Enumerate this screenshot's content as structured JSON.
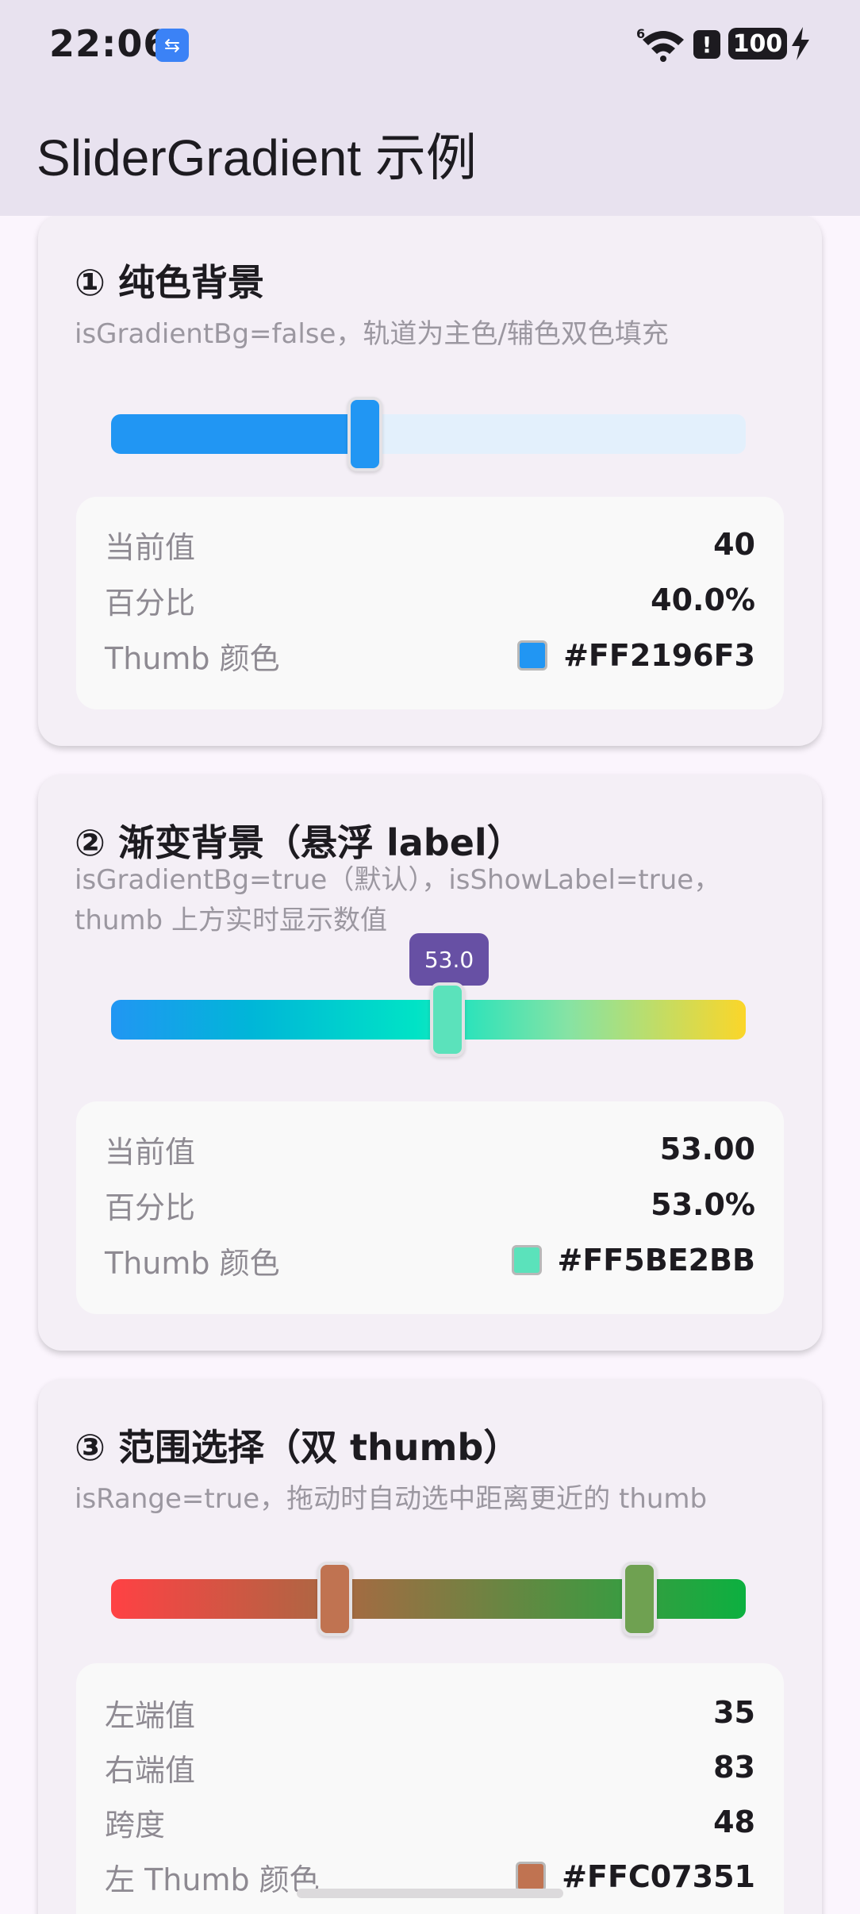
{
  "status_bar": {
    "time": "22:06",
    "usb_icon": "usb-icon",
    "signal_label": "6",
    "alert_glyph": "!",
    "battery": "100",
    "icons": [
      "usb-icon",
      "wifi-icon",
      "alert-icon",
      "battery-icon",
      "charging-bolt-icon"
    ]
  },
  "app_bar": {
    "title": "SliderGradient 示例"
  },
  "cards": [
    {
      "title": "① 纯色背景",
      "desc": "isGradientBg=false，轨道为主色/辅色双色填充",
      "slider": {
        "value": 40,
        "min": 0,
        "max": 100,
        "active_color": "#2196F3",
        "inactive_color": "#E3F0FC"
      },
      "rows": [
        {
          "key": "当前值",
          "value": "40"
        },
        {
          "key": "百分比",
          "value": "40.0%"
        },
        {
          "key": "Thumb 颜色",
          "value": "#FF2196F3",
          "swatch": "#2196F3"
        }
      ]
    },
    {
      "title": "② 渐变背景（悬浮 label）",
      "desc_line1": "isGradientBg=true（默认），isShowLabel=true，",
      "desc_line2": "thumb 上方实时显示数值",
      "slider": {
        "value": 53.0,
        "min": 0,
        "max": 100,
        "label": "53.0",
        "gradient": [
          "#2196F3",
          "#00D2D3",
          "#FBD629"
        ],
        "thumb_color": "#5BE2BB"
      },
      "rows": [
        {
          "key": "当前值",
          "value": "53.00"
        },
        {
          "key": "百分比",
          "value": "53.0%"
        },
        {
          "key": "Thumb 颜色",
          "value": "#FF5BE2BB",
          "swatch": "#5BE2BB"
        }
      ]
    },
    {
      "title": "③ 范围选择（双 thumb）",
      "desc": "isRange=true，拖动时自动选中距离更近的 thumb",
      "slider": {
        "left_value": 35,
        "right_value": 83,
        "min": 0,
        "max": 100,
        "gradient": [
          "#FF4144",
          "#0CB040"
        ],
        "left_thumb": "#C07351",
        "right_thumb": "#6FA151"
      },
      "rows": [
        {
          "key": "左端值",
          "value": "35"
        },
        {
          "key": "右端值",
          "value": "83"
        },
        {
          "key": "跨度",
          "value": "48"
        },
        {
          "key": "左 Thumb 颜色",
          "value": "#FFC07351",
          "swatch": "#C07351"
        }
      ]
    }
  ]
}
